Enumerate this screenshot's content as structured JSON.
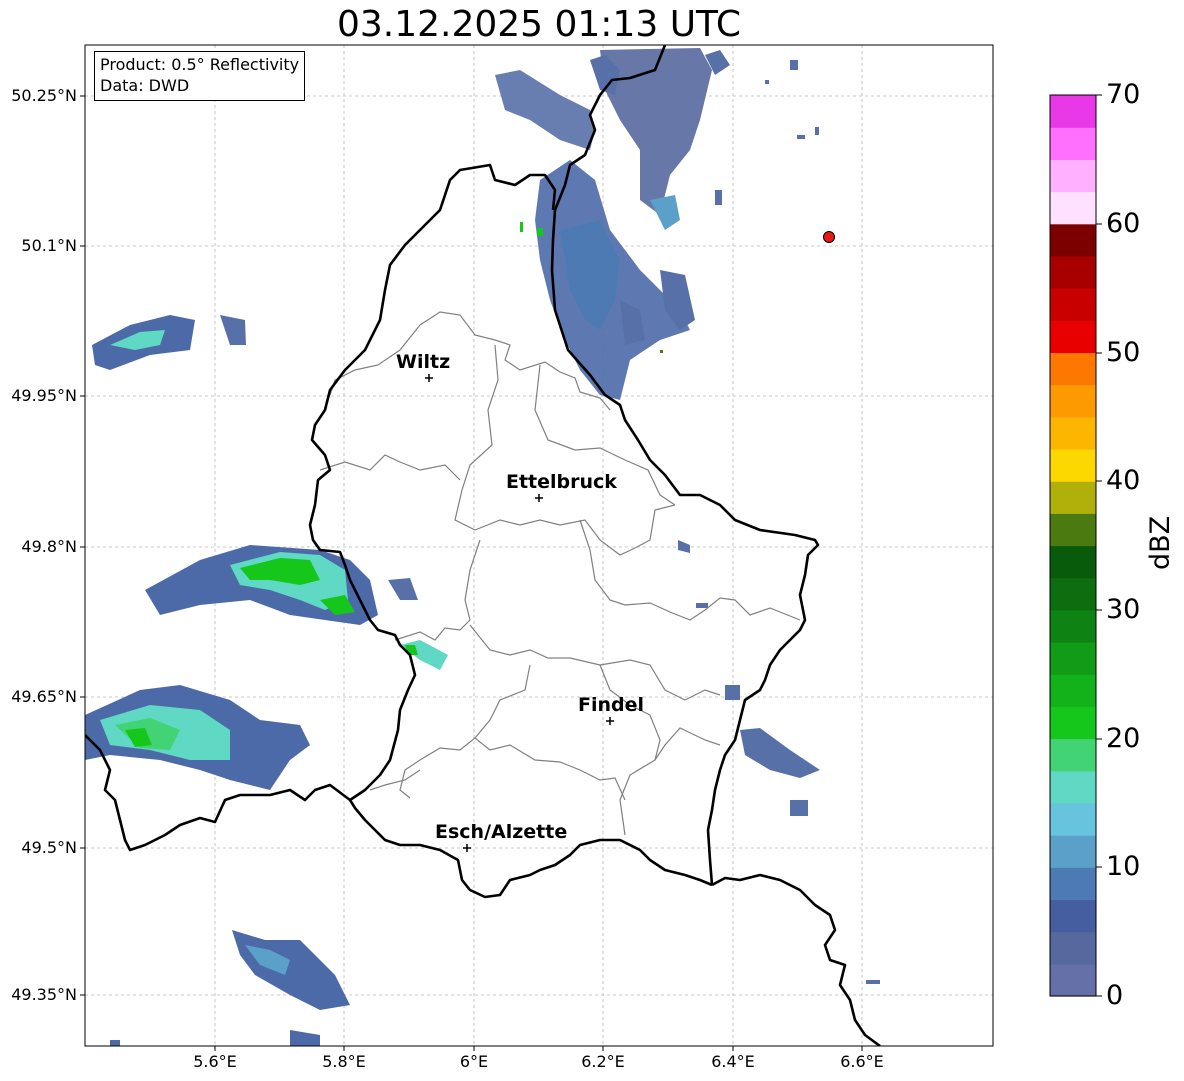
{
  "title": "03.12.2025 01:13 UTC",
  "info": {
    "product": "Product: 0.5° Reflectivity",
    "data_source": "Data: DWD"
  },
  "axes": {
    "x_ticks": [
      "5.6°E",
      "5.8°E",
      "6°E",
      "6.2°E",
      "6.4°E",
      "6.6°E"
    ],
    "y_ticks": [
      "50.25°N",
      "50.1°N",
      "49.95°N",
      "49.8°N",
      "49.65°N",
      "49.5°N",
      "49.35°N"
    ]
  },
  "cities": [
    {
      "name": "Wiltz"
    },
    {
      "name": "Ettelbruck"
    },
    {
      "name": "Findel"
    },
    {
      "name": "Esch/Alzette"
    }
  ],
  "colorbar": {
    "label": "dBZ",
    "ticks": [
      "0",
      "10",
      "20",
      "30",
      "40",
      "50",
      "60",
      "70"
    ],
    "colors": [
      "#6670a8",
      "#56699f",
      "#455ea0",
      "#4d7ab5",
      "#5aa0c8",
      "#66c4de",
      "#5fd8c4",
      "#42d474",
      "#14c71a",
      "#12b21a",
      "#119c18",
      "#0d8314",
      "#0d6e10",
      "#085b0a",
      "#4a7a10",
      "#b0b00a",
      "#fcd800",
      "#fcb600",
      "#fc9a00",
      "#fc7800",
      "#e80000",
      "#c80000",
      "#a80000",
      "#7c0000",
      "#ffe0ff",
      "#ffb0ff",
      "#ff70ff",
      "#e838e8"
    ]
  },
  "radar_marker": {
    "color": "#e81818"
  }
}
